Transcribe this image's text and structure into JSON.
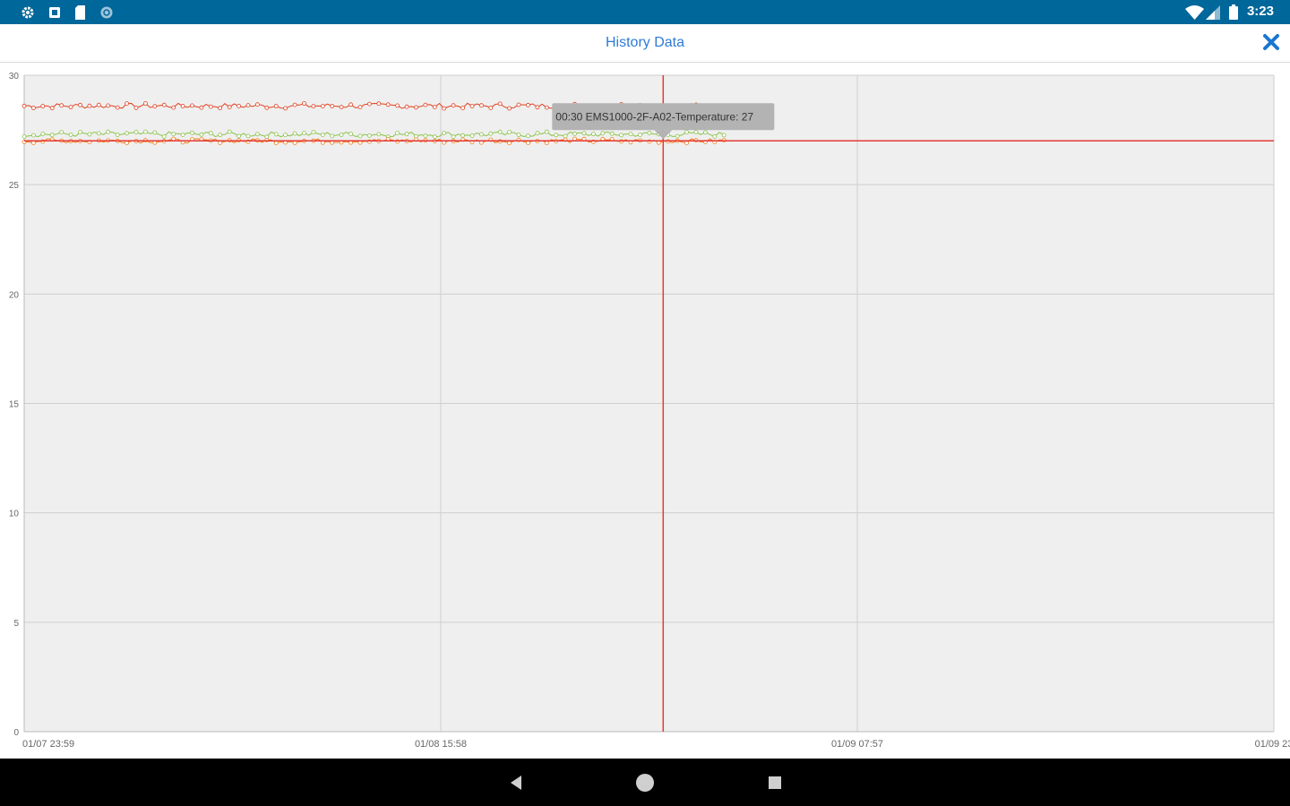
{
  "status_bar": {
    "left_icons": [
      "settings-icon",
      "notification-icon",
      "sd-card-icon",
      "sync-icon"
    ],
    "right_icons": [
      "wifi-icon",
      "signal-icon",
      "battery-icon"
    ],
    "time": "3:23"
  },
  "app_bar": {
    "title": "History Data",
    "close_icon": "close-icon",
    "accent_color": "#2e7bd6"
  },
  "nav_bar": {
    "buttons": [
      "back-icon",
      "home-icon",
      "recents-icon"
    ]
  },
  "chart_data": {
    "type": "line",
    "title": "",
    "xlabel": "",
    "ylabel": "",
    "ylim": [
      0,
      30
    ],
    "yticks": [
      0,
      5,
      10,
      15,
      20,
      25,
      30
    ],
    "xlim": [
      0,
      1.5
    ],
    "xticks": [
      {
        "value": 0,
        "label": "01/07 23:59"
      },
      {
        "value": 0.5,
        "label": "01/08 15:58"
      },
      {
        "value": 1.0,
        "label": "01/09 07:57"
      },
      {
        "value": 1.5,
        "label": "01/09 23"
      }
    ],
    "grid": true,
    "background_color": "#efefef",
    "series": [
      {
        "color": "#e04020",
        "x_start": 0,
        "x_end": 0.84,
        "level": 28.6,
        "noise": 0.12
      },
      {
        "color": "#8bc34a",
        "x_start": 0,
        "x_end": 0.84,
        "level": 27.3,
        "noise": 0.12
      },
      {
        "color": "#f08020",
        "x_start": 0,
        "x_end": 0.84,
        "level": 27.0,
        "noise": 0.1
      }
    ],
    "crosshair": {
      "x": 0.767,
      "y": 27,
      "color": "#e53935"
    },
    "tooltip": {
      "text": "00:30  EMS1000-2F-A02-Temperature: 27"
    }
  }
}
